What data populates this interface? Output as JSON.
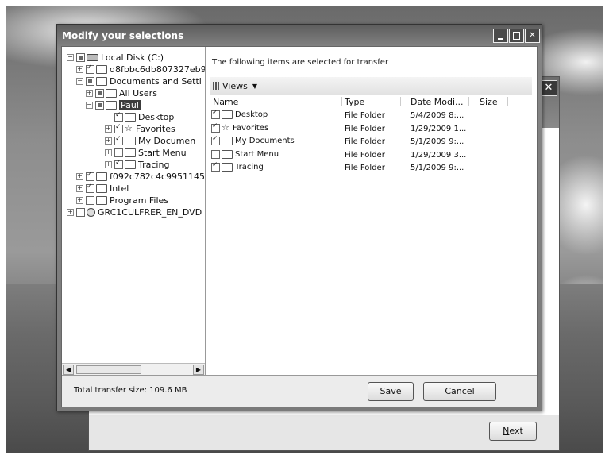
{
  "dialog": {
    "title": "Modify your selections",
    "caption_buttons": [
      "minimize",
      "maximize",
      "close"
    ]
  },
  "tree": {
    "items": [
      {
        "label": "Local Disk (C:)",
        "icon": "drive-icon",
        "expander": "−",
        "check": "partial"
      },
      {
        "label": "d8fbbc6db807327eb9",
        "icon": "folder-icon",
        "expander": "+",
        "check": "on"
      },
      {
        "label": "Documents and Setti",
        "icon": "folder-icon",
        "expander": "−",
        "check": "partial"
      },
      {
        "label": "All Users",
        "icon": "folder-icon",
        "expander": "+",
        "check": "partial"
      },
      {
        "label": "Paul",
        "icon": "folder-icon",
        "expander": "−",
        "check": "partial",
        "selected": true
      },
      {
        "label": "Desktop",
        "icon": "folder-icon",
        "expander": "",
        "check": "on"
      },
      {
        "label": "Favorites",
        "icon": "star-icon",
        "expander": "+",
        "check": "on"
      },
      {
        "label": "My Documen",
        "icon": "folder-icon",
        "expander": "+",
        "check": "on"
      },
      {
        "label": "Start Menu",
        "icon": "folder-icon",
        "expander": "+",
        "check": "off"
      },
      {
        "label": "Tracing",
        "icon": "folder-icon",
        "expander": "+",
        "check": "on"
      },
      {
        "label": "f092c782c4c9951145",
        "icon": "folder-icon",
        "expander": "+",
        "check": "on"
      },
      {
        "label": "Intel",
        "icon": "folder-icon",
        "expander": "+",
        "check": "on"
      },
      {
        "label": "Program Files",
        "icon": "folder-icon",
        "expander": "+",
        "check": "off"
      },
      {
        "label": "GRC1CULFRER_EN_DVD",
        "icon": "dvd-icon",
        "expander": "+",
        "check": "off"
      }
    ]
  },
  "list": {
    "header_text": "The following items are selected for transfer",
    "views_label": "Views",
    "columns": [
      "Name",
      "Type",
      "Date Modi...",
      "Size"
    ],
    "rows": [
      {
        "name": "Desktop",
        "icon": "folder-icon",
        "checked": true,
        "type": "File Folder",
        "date": "5/4/2009 8:..."
      },
      {
        "name": "Favorites",
        "icon": "star-icon",
        "checked": true,
        "type": "File Folder",
        "date": "1/29/2009 1..."
      },
      {
        "name": "My Documents",
        "icon": "folder-icon",
        "checked": true,
        "type": "File Folder",
        "date": "5/1/2009 9:..."
      },
      {
        "name": "Start Menu",
        "icon": "folder-icon",
        "checked": false,
        "type": "File Folder",
        "date": "1/29/2009 3..."
      },
      {
        "name": "Tracing",
        "icon": "folder-icon",
        "checked": true,
        "type": "File Folder",
        "date": "5/1/2009 9:..."
      }
    ]
  },
  "footer": {
    "total_size": "Total transfer size: 109.6 MB",
    "save_label": "Save",
    "cancel_label": "Cancel"
  },
  "background_window": {
    "next_label": "ext",
    "next_accel": "N",
    "close_glyph": "✕"
  }
}
